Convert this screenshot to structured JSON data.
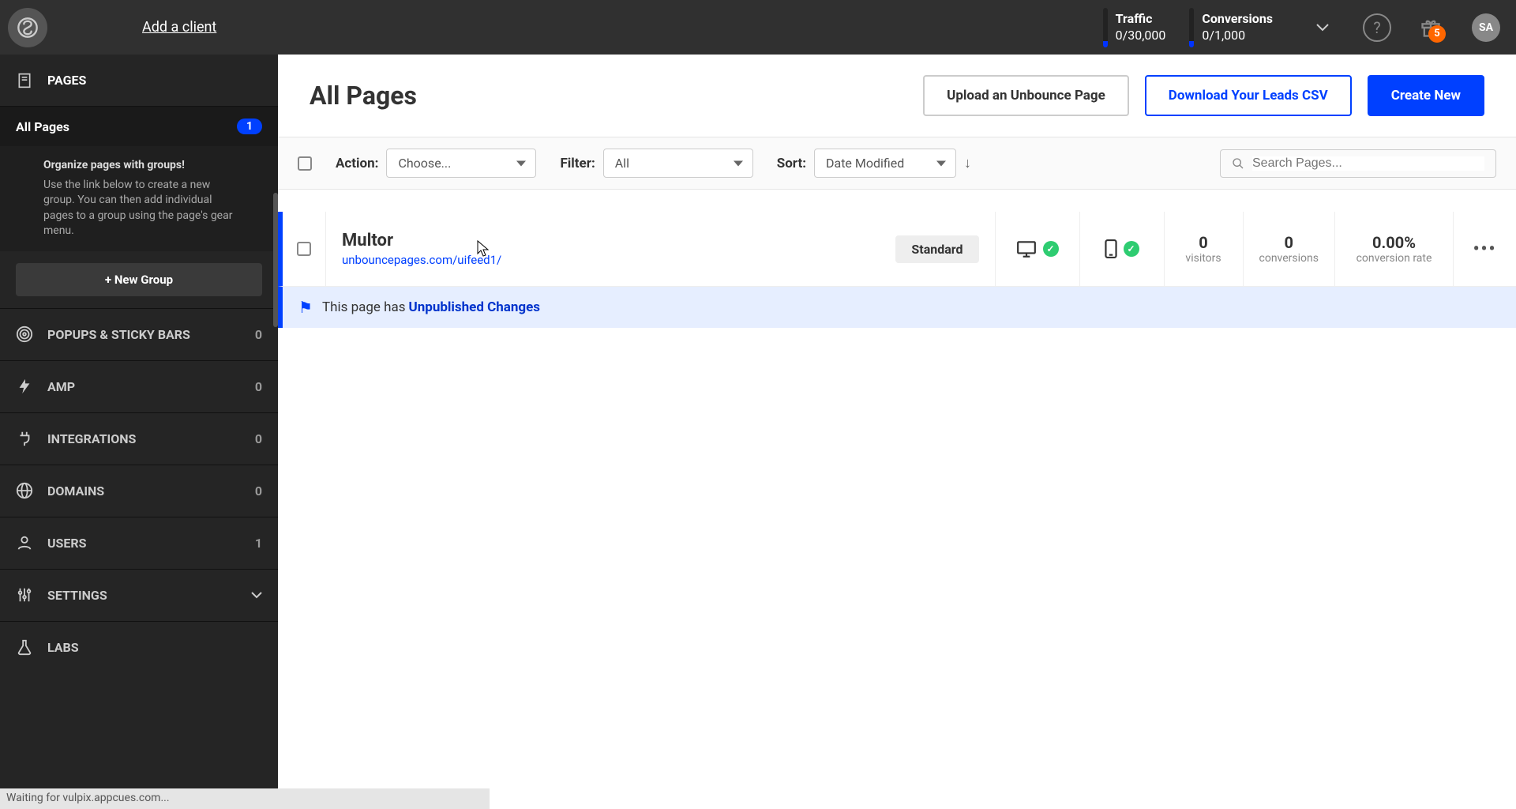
{
  "topbar": {
    "add_client": "Add a client",
    "traffic_label": "Traffic",
    "traffic_value": "0/30,000",
    "conversions_label": "Conversions",
    "conversions_value": "0/1,000",
    "gift_badge": "5",
    "avatar": "SA"
  },
  "sidebar": {
    "pages_label": "PAGES",
    "all_pages_label": "All Pages",
    "all_pages_count": "1",
    "help_title": "Organize pages with groups!",
    "help_text": "Use the link below to create a new group. You can then add individual pages to a group using the page's gear menu.",
    "new_group_btn": "+ New Group",
    "items": [
      {
        "label": "POPUPS & STICKY BARS",
        "count": "0"
      },
      {
        "label": "AMP",
        "count": "0"
      },
      {
        "label": "INTEGRATIONS",
        "count": "0"
      },
      {
        "label": "DOMAINS",
        "count": "0"
      },
      {
        "label": "USERS",
        "count": "1"
      },
      {
        "label": "SETTINGS",
        "count": ""
      },
      {
        "label": "LABS",
        "count": ""
      }
    ]
  },
  "header": {
    "title": "All Pages",
    "upload_btn": "Upload an Unbounce Page",
    "download_btn": "Download Your Leads CSV",
    "create_btn": "Create New"
  },
  "toolbar": {
    "action_label": "Action:",
    "action_value": "Choose...",
    "filter_label": "Filter:",
    "filter_value": "All",
    "sort_label": "Sort:",
    "sort_value": "Date Modified",
    "search_placeholder": "Search Pages..."
  },
  "row": {
    "name": "Multor",
    "url": "unbouncepages.com/uifeed1/",
    "badge": "Standard",
    "visitors_num": "0",
    "visitors_lbl": "visitors",
    "conversions_num": "0",
    "conversions_lbl": "conversions",
    "rate_num": "0.00%",
    "rate_lbl": "conversion rate"
  },
  "notice": {
    "prefix": "This page has ",
    "strong": "Unpublished Changes"
  },
  "statusbar": "Waiting for vulpix.appcues.com..."
}
